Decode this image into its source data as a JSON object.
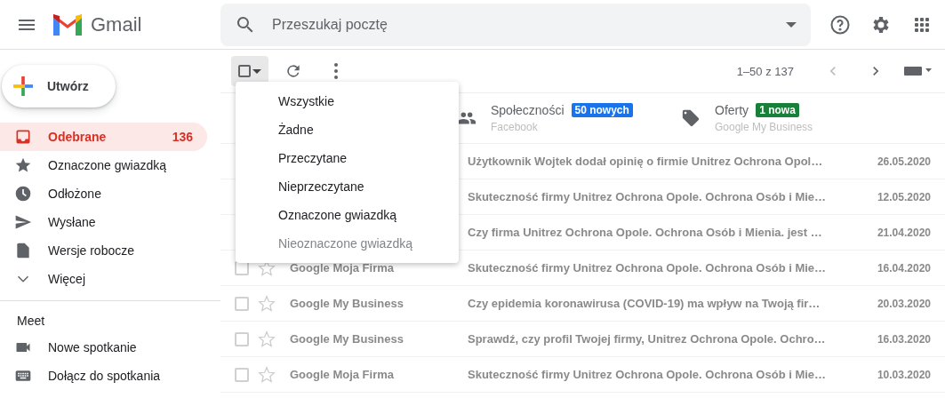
{
  "header": {
    "app_name": "Gmail",
    "search": {
      "placeholder": "Przeszukaj pocztę"
    }
  },
  "compose": {
    "label": "Utwórz"
  },
  "sidebar": {
    "items": [
      {
        "label": "Odebrane",
        "count": "136",
        "selected": true
      },
      {
        "label": "Oznaczone gwiazdką",
        "selected": false
      },
      {
        "label": "Odłożone",
        "selected": false
      },
      {
        "label": "Wysłane",
        "selected": false
      },
      {
        "label": "Wersje robocze",
        "selected": false
      },
      {
        "label": "Więcej",
        "selected": false
      }
    ],
    "meet": {
      "title": "Meet",
      "items": [
        {
          "label": "Nowe spotkanie"
        },
        {
          "label": "Dołącz do spotkania"
        }
      ]
    }
  },
  "toolbar": {
    "pagination": "1–50 z 137",
    "select_all_checked": false
  },
  "tabs": [
    {
      "label": "Społeczności",
      "badge": "50 nowych",
      "color": "#1a73e8",
      "subtitle": "Facebook"
    },
    {
      "label": "Oferty",
      "badge": "1 nowa",
      "color": "#188038",
      "subtitle": "Google My Business"
    }
  ],
  "select_menu": {
    "items": [
      {
        "label": "Wszystkie",
        "disabled": false
      },
      {
        "label": "Żadne",
        "disabled": false
      },
      {
        "label": "Przeczytane",
        "disabled": false
      },
      {
        "label": "Nieprzeczytane",
        "disabled": false
      },
      {
        "label": "Oznaczone gwiazdką",
        "disabled": false
      },
      {
        "label": "Nieoznaczone gwiazdką",
        "disabled": true
      }
    ]
  },
  "messages": [
    {
      "subject": "Użytkownik Wojtek dodał opinię o firmie Unitrez Ochrona Opol…",
      "date": "26.05.2020"
    },
    {
      "subject": "Skuteczność firmy Unitrez Ochrona Opole. Ochrona Osób i Mie…",
      "date": "12.05.2020"
    },
    {
      "subject": "Czy firma Unitrez Ochrona Opole. Ochrona Osób i Mienia. jest …",
      "date": "21.04.2020"
    },
    {
      "sender": "Google Moja Firma",
      "subject": "Skuteczność firmy Unitrez Ochrona Opole. Ochrona Osób i Mie…",
      "date": "16.04.2020",
      "checked": false
    },
    {
      "sender": "Google My Business",
      "subject": "Czy epidemia koronawirusa (COVID-19) ma wpływ na Twoją fir…",
      "date": "20.03.2020",
      "checked": false
    },
    {
      "sender": "Google My Business",
      "subject": "Sprawdź, czy profil Twojej firmy, Unitrez Ochrona Opole. Ochro…",
      "date": "16.03.2020",
      "checked": false
    },
    {
      "sender": "Google Moja Firma",
      "subject": "Skuteczność firmy Unitrez Ochrona Opole. Ochrona Osób i Mie…",
      "date": "10.03.2020",
      "checked": false
    }
  ]
}
